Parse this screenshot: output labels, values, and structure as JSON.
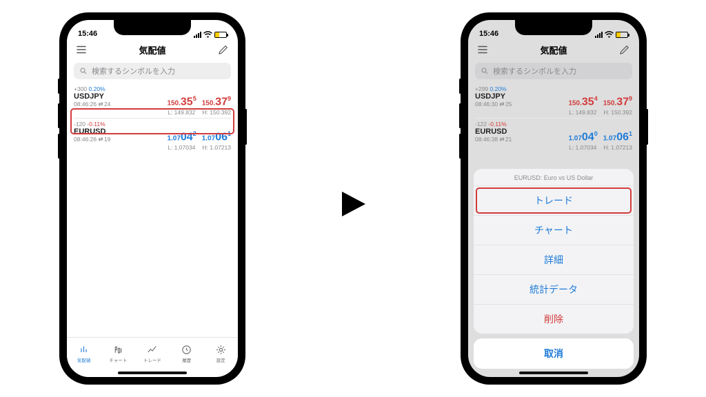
{
  "status": {
    "time": "15:46"
  },
  "header": {
    "title": "気配値",
    "search_placeholder": "検索するシンボルを入力"
  },
  "left": {
    "rows": [
      {
        "delta": "+300",
        "pct": "0.20%",
        "dir": "up",
        "symbol": "USDJPY",
        "time": "08:46:26",
        "spread": "24",
        "bid_a": "150.",
        "bid_b": "35",
        "bid_c": "5",
        "ask_a": "150.",
        "ask_b": "37",
        "ask_c": "9",
        "low": "L: 149.832",
        "high": "H: 150.392",
        "bid_cls": "red",
        "ask_cls": "red"
      },
      {
        "delta": "-120",
        "pct": "-0.11%",
        "dir": "dn",
        "symbol": "EURUSD",
        "time": "08:46:26",
        "spread": "19",
        "bid_a": "1.07",
        "bid_b": "04",
        "bid_c": "2",
        "ask_a": "1.07",
        "ask_b": "06",
        "ask_c": "1",
        "low": "L: 1.07034",
        "high": "H: 1.07213",
        "bid_cls": "blue",
        "ask_cls": "blue"
      }
    ]
  },
  "right": {
    "rows": [
      {
        "delta": "+299",
        "pct": "0.20%",
        "dir": "up",
        "symbol": "USDJPY",
        "time": "08:46:30",
        "spread": "25",
        "bid_a": "150.",
        "bid_b": "35",
        "bid_c": "4",
        "ask_a": "150.",
        "ask_b": "37",
        "ask_c": "9",
        "low": "L: 149.832",
        "high": "H: 150.392",
        "bid_cls": "red",
        "ask_cls": "red"
      },
      {
        "delta": "-122",
        "pct": "-0.11%",
        "dir": "dn",
        "symbol": "EURUSD",
        "time": "08:46:38",
        "spread": "21",
        "bid_a": "1.07",
        "bid_b": "04",
        "bid_c": "0",
        "ask_a": "1.07",
        "ask_b": "06",
        "ask_c": "1",
        "low": "L: 1.07034",
        "high": "H: 1.07213",
        "bid_cls": "blue",
        "ask_cls": "blue"
      }
    ]
  },
  "tabs": [
    "気配値",
    "チャート",
    "トレード",
    "履歴",
    "設定"
  ],
  "sheet": {
    "title": "EURUSD: Euro vs US Dollar",
    "options": [
      "トレード",
      "チャート",
      "詳細",
      "統計データ",
      "削除"
    ],
    "cancel": "取消"
  }
}
